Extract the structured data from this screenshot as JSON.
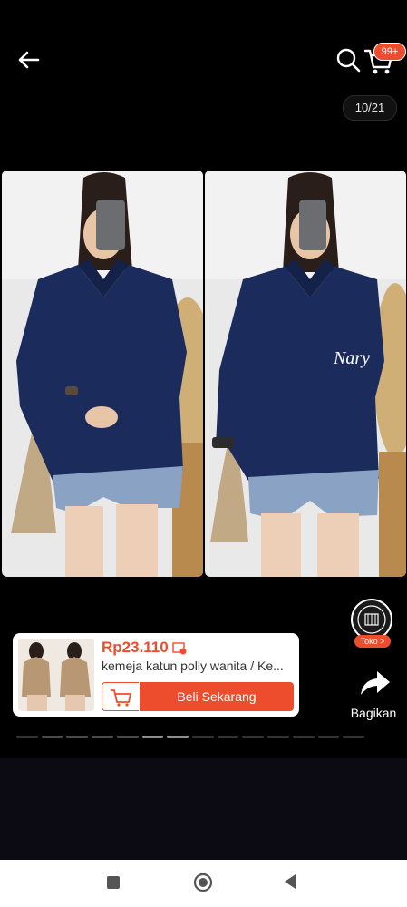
{
  "header": {
    "cart_badge": "99+",
    "image_counter": "10/21"
  },
  "image": {
    "color_label": "Nary"
  },
  "seller": {
    "shop_label": "Toko >"
  },
  "actions": {
    "share_label": "Bagikan"
  },
  "product": {
    "price": "Rp23.110",
    "title": "kemeja katun polly wanita / Ke...",
    "buy_label": "Beli Sekarang"
  },
  "colors": {
    "accent": "#ee4d2d",
    "shirt": "#1a2b5c",
    "background": "#000000"
  }
}
